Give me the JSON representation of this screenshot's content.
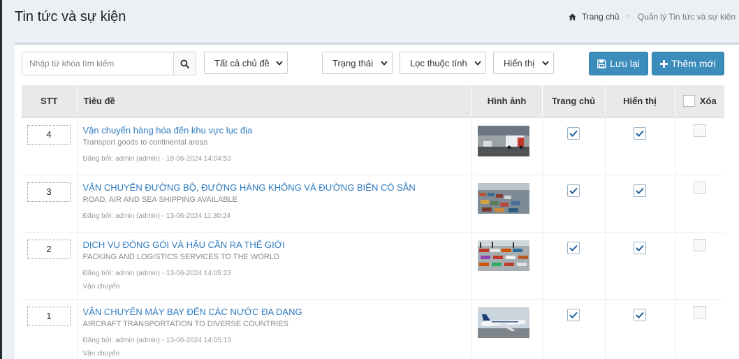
{
  "header": {
    "title": "Tin tức và sự kiện",
    "breadcrumb": {
      "home": "Trang chủ",
      "current": "Quản lý Tin tức và sự kiện"
    }
  },
  "toolbar": {
    "search_placeholder": "Nhập từ khóa tìm kiếm",
    "topic_select": "Tất cả chủ đề",
    "status_select": "Trạng thái",
    "attribute_select": "Lọc thuộc tính",
    "display_select": "Hiển thị",
    "save_label": "Lưu lại",
    "add_label": "Thêm mới"
  },
  "table": {
    "headers": {
      "stt": "STT",
      "title": "Tiêu đề",
      "image": "Hình ảnh",
      "home": "Trang chủ",
      "display": "Hiển thị",
      "delete": "Xóa"
    },
    "rows": [
      {
        "stt": "4",
        "title": "Vận chuyển hàng hóa đến khu vực lục địa",
        "subtitle": "Transport goods to continental areas",
        "meta": "Đăng bởi: admin (admin) - 18-06-2024 14:04:53",
        "category": "",
        "home_checked": true,
        "display_checked": true,
        "image_icon": "truck-photo"
      },
      {
        "stt": "3",
        "title": "VẬN CHUYỂN ĐƯỜNG BỘ, ĐƯỜNG HÀNG KHÔNG VÀ ĐƯỜNG BIỂN CÓ SẴN",
        "subtitle": "ROAD, AIR AND SEA SHIPPING AVAILABLE",
        "meta": "Đăng bởi: admin (admin) - 13-06-2024 11:30:24",
        "category": "",
        "home_checked": true,
        "display_checked": true,
        "image_icon": "port-photo"
      },
      {
        "stt": "2",
        "title": "DỊCH VỤ ĐÓNG GÓI VÀ HẬU CẦN RA THẾ GIỚI",
        "subtitle": "PACKING AND LOGISTICS SERVICES TO THE WORLD",
        "meta": "Đăng bởi: admin (admin) - 13-06-2024 14:05:23",
        "category": "Vận chuyển",
        "home_checked": true,
        "display_checked": true,
        "image_icon": "container-yard-photo"
      },
      {
        "stt": "1",
        "title": "VẬN CHUYỂN MÁY BAY ĐẾN CÁC NƯỚC ĐA DẠNG",
        "subtitle": "AIRCRAFT TRANSPORTATION TO DIVERSE COUNTRIES",
        "meta": "Đăng bởi: admin (admin) - 13-06-2024 14:05:13",
        "category": "Vận chuyển",
        "home_checked": true,
        "display_checked": true,
        "image_icon": "airplane-photo"
      }
    ]
  },
  "colors": {
    "link": "#2f7bbf",
    "primary": "#3c8dbc",
    "page_bg": "#ecf0f5"
  }
}
